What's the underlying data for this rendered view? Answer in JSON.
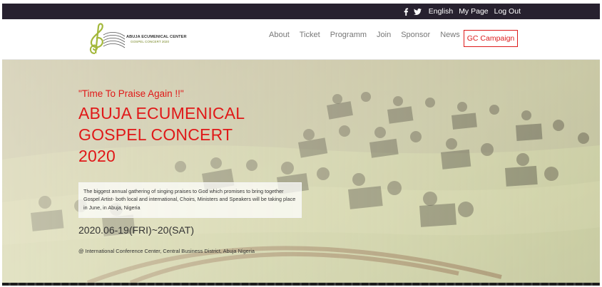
{
  "topbar": {
    "social": [
      {
        "icon": "facebook-icon",
        "glyph": "f"
      },
      {
        "icon": "twitter-icon"
      }
    ],
    "links": [
      "English",
      "My Page",
      "Log Out"
    ],
    "background": "#27212f"
  },
  "logo": {
    "title": "ABUJA ECUMENICAL CENTER",
    "subtitle": "GOSPEL CONCERT 2020",
    "mark_color": "#a3b83b"
  },
  "nav": {
    "items": [
      "About",
      "Ticket",
      "Programm",
      "Join",
      "Sponsor",
      "News"
    ],
    "cta": "GC Campaign",
    "accent": "#dd1b1b"
  },
  "hero": {
    "tagline": "\"Time To Praise Again !!\"",
    "title_lines": [
      "ABUJA ECUMENICAL",
      "GOSPEL CONCERT",
      "2020"
    ],
    "description": "The biggest annual gathering of singing praises to God which promises to bring together Gospel Artist- both local and international, Choirs, Ministers and Speakers will be taking place in June, in Abuja, Nigeria",
    "date": "2020.06-19(FRI)~20(SAT)",
    "venue": "@ International Conference Center, Central Business District, Abuja Nigeria",
    "title_color": "#e01818"
  }
}
